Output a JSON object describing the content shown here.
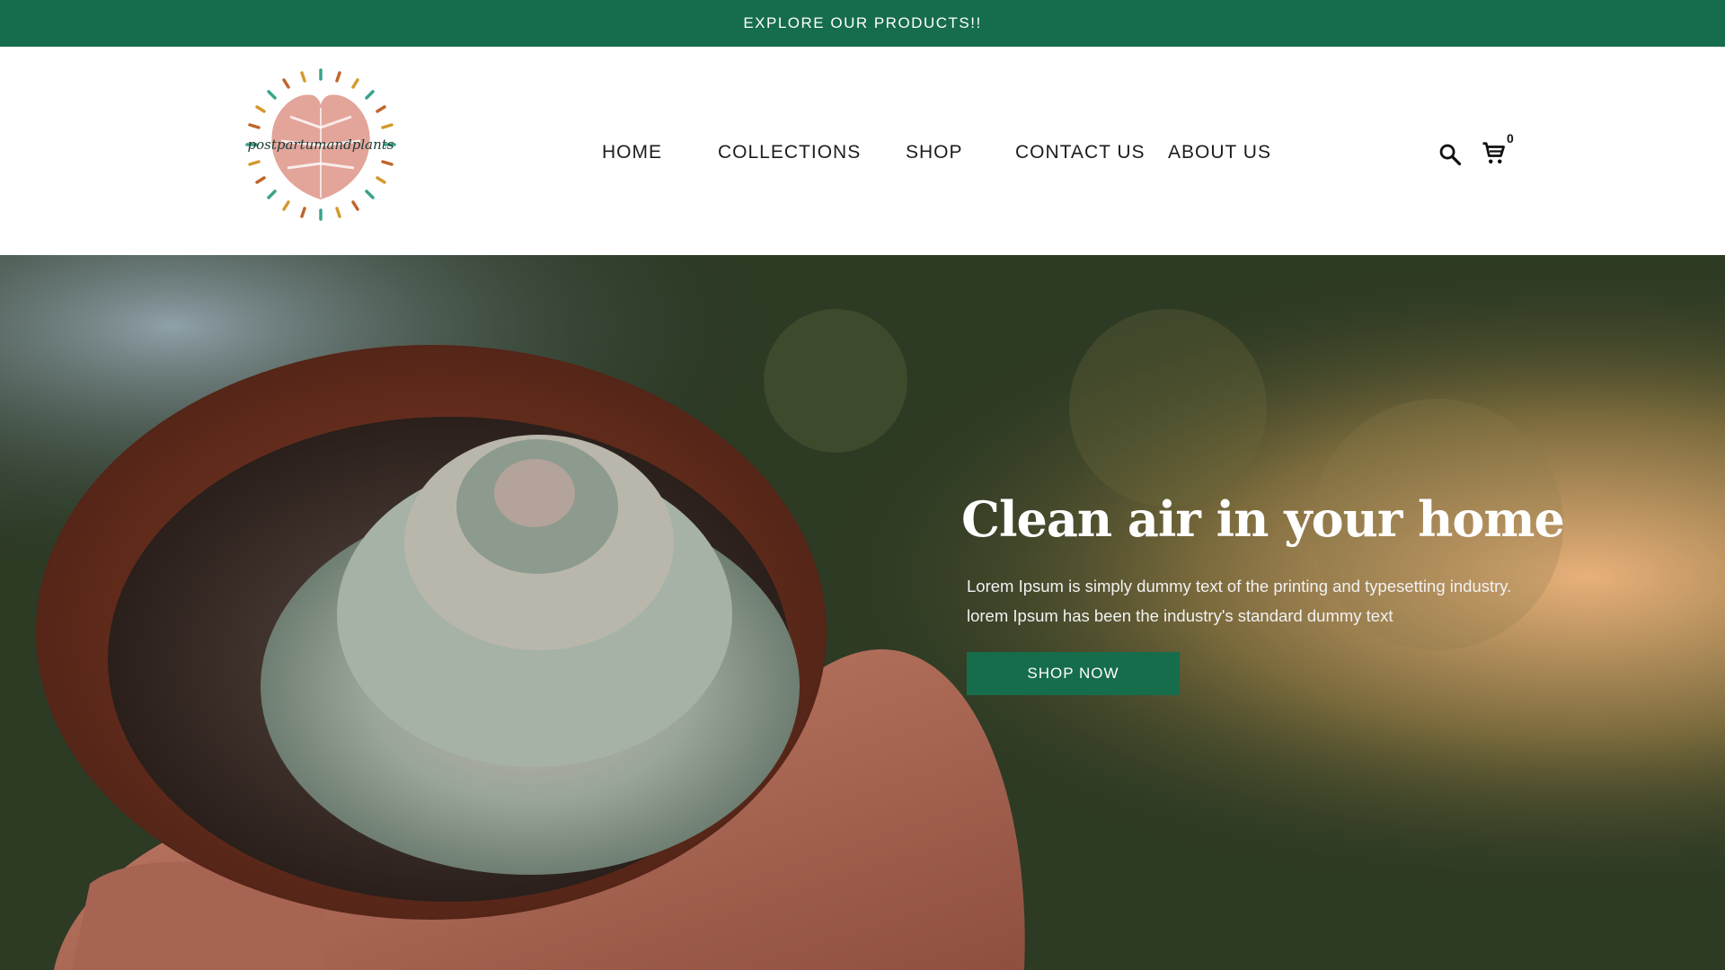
{
  "announcement": {
    "text": "EXPLORE OUR PRODUCTS!!"
  },
  "header": {
    "logo_text": "postpartumandplants",
    "nav": [
      {
        "label": "HOME"
      },
      {
        "label": "COLLECTIONS"
      },
      {
        "label": "SHOP"
      },
      {
        "label": "CONTACT US"
      },
      {
        "label": "ABOUT US"
      }
    ],
    "icons": {
      "search": "search-icon",
      "cart": "cart-icon"
    },
    "cart_count": "0"
  },
  "hero": {
    "title": "Clean air in your home",
    "text_line1": "Lorem Ipsum is simply dummy text of the printing and typesetting industry.",
    "text_line2": "lorem Ipsum has been the industry's standard dummy text",
    "button_label": "SHOP NOW"
  },
  "colors": {
    "brand_green": "#166d4b",
    "logo_pink": "#e3a49a",
    "white": "#ffffff"
  }
}
